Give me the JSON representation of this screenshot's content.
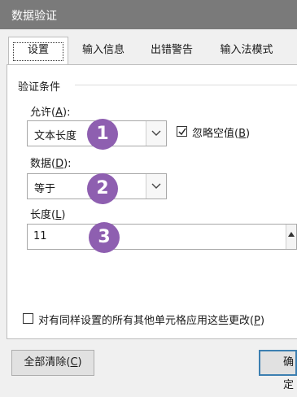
{
  "window": {
    "title": "数据验证"
  },
  "tabs": [
    {
      "label": "设置",
      "active": true
    },
    {
      "label": "输入信息",
      "active": false
    },
    {
      "label": "出错警告",
      "active": false
    },
    {
      "label": "输入法模式",
      "active": false
    }
  ],
  "criteria": {
    "group_title": "验证条件",
    "allow": {
      "label": "允许",
      "hotkey": "A",
      "value": "文本长度"
    },
    "ignore_blank": {
      "label": "忽略空值",
      "hotkey": "B",
      "checked": true
    },
    "data": {
      "label": "数据",
      "hotkey": "D",
      "value": "等于"
    },
    "length": {
      "label": "长度",
      "hotkey": "L",
      "value": "11"
    }
  },
  "badges": [
    "1",
    "2",
    "3"
  ],
  "apply_all": {
    "label": "对有同样设置的所有其他单元格应用这些更改",
    "hotkey": "P",
    "checked": false
  },
  "footer": {
    "clear_all": {
      "label": "全部清除",
      "hotkey": "C"
    },
    "ok": {
      "label": "确定"
    }
  },
  "colors": {
    "title_bar": "#7a7a7a",
    "badge": "#8e5fb0",
    "primary_border": "#3c7fb1"
  }
}
